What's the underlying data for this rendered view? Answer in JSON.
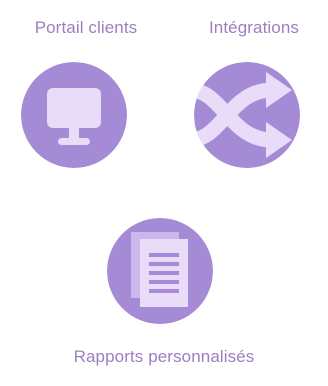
{
  "colors": {
    "label_text": "#9b7fc1",
    "circle_fill": "#a58ad6",
    "icon_light": "#e9dcf8",
    "icon_mid": "#cdb7ec",
    "icon_line": "#a68ad7"
  },
  "features": [
    {
      "label": "Portail clients",
      "icon": "monitor-icon"
    },
    {
      "label": "Intégrations",
      "icon": "shuffle-arrows-icon"
    },
    {
      "label": "Rapports personnalisés",
      "icon": "document-icon"
    }
  ]
}
